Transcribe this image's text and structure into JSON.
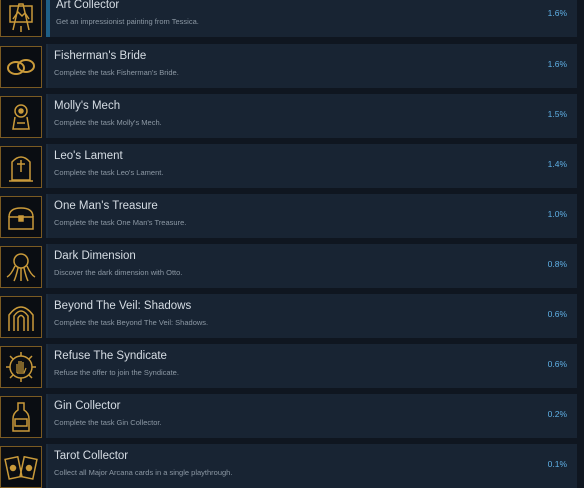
{
  "achievements": [
    {
      "title": "Art Collector",
      "description": "Get an impressionist painting from Tessica.",
      "percent": "1.6%",
      "icon": "painting-easel-icon"
    },
    {
      "title": "Fisherman's Bride",
      "description": "Complete the task Fisherman's Bride.",
      "percent": "1.6%",
      "icon": "wedding-rings-icon"
    },
    {
      "title": "Molly's Mech",
      "description": "Complete the task Molly's Mech.",
      "percent": "1.5%",
      "icon": "mechanical-arm-icon"
    },
    {
      "title": "Leo's Lament",
      "description": "Complete the task Leo's Lament.",
      "percent": "1.4%",
      "icon": "gravestone-icon"
    },
    {
      "title": "One Man's Treasure",
      "description": "Complete the task One Man's Treasure.",
      "percent": "1.0%",
      "icon": "treasure-chest-icon"
    },
    {
      "title": "Dark Dimension",
      "description": "Discover the dark dimension with Otto.",
      "percent": "0.8%",
      "icon": "octopus-icon"
    },
    {
      "title": "Beyond The Veil: Shadows",
      "description": "Complete the task Beyond The Veil: Shadows.",
      "percent": "0.6%",
      "icon": "portal-arch-icon"
    },
    {
      "title": "Refuse The Syndicate",
      "description": "Refuse the offer to join the Syndicate.",
      "percent": "0.6%",
      "icon": "gear-hand-icon"
    },
    {
      "title": "Gin Collector",
      "description": "Complete the task Gin Collector.",
      "percent": "0.2%",
      "icon": "gin-bottle-icon"
    },
    {
      "title": "Tarot Collector",
      "description": "Collect all Major Arcana cards in a single playthrough.",
      "percent": "0.1%",
      "icon": "tarot-cards-icon"
    }
  ],
  "colors": {
    "background": "#0f1620",
    "card": "#182433",
    "percent_text": "#5fb0e6",
    "icon_gold": "#c99a3a",
    "progress_bar": "#1e5f86"
  }
}
